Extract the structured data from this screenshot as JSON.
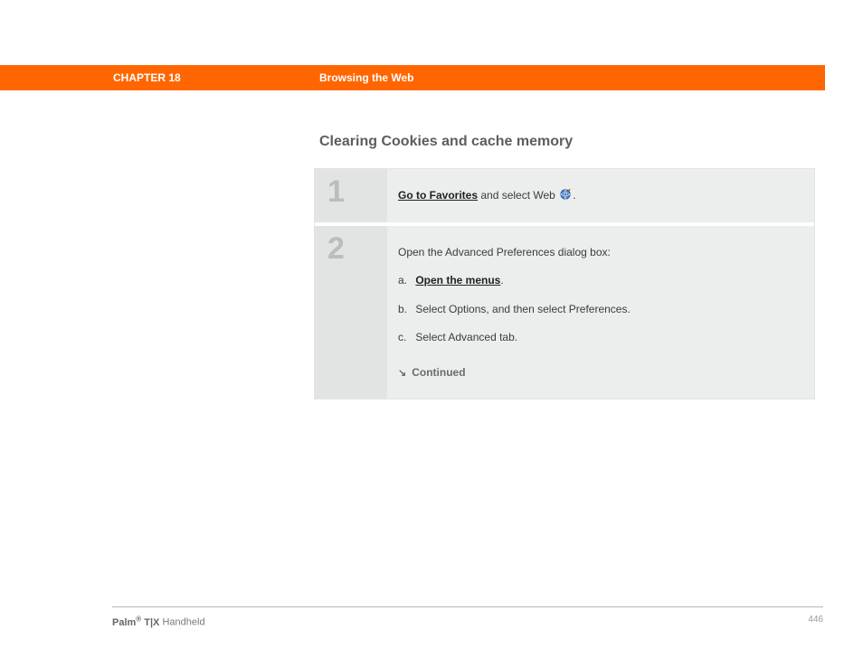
{
  "header": {
    "chapter": "CHAPTER 18",
    "title": "Browsing the Web"
  },
  "section_heading": "Clearing Cookies and cache memory",
  "steps": [
    {
      "num": "1",
      "link": "Go to Favorites",
      "after_link": " and select Web ",
      "tail": "."
    },
    {
      "num": "2",
      "intro": "Open the Advanced Preferences dialog box:",
      "subs": [
        {
          "letter": "a.",
          "link": "Open the menus",
          "after": "."
        },
        {
          "letter": "b.",
          "text": "Select Options, and then select Preferences."
        },
        {
          "letter": "c.",
          "text": "Select Advanced tab."
        }
      ],
      "continued": "Continued"
    }
  ],
  "footer": {
    "brand_bold": "Palm",
    "brand_sup": "®",
    "brand_mid": " T|X",
    "brand_rest": " Handheld",
    "page": "446"
  }
}
